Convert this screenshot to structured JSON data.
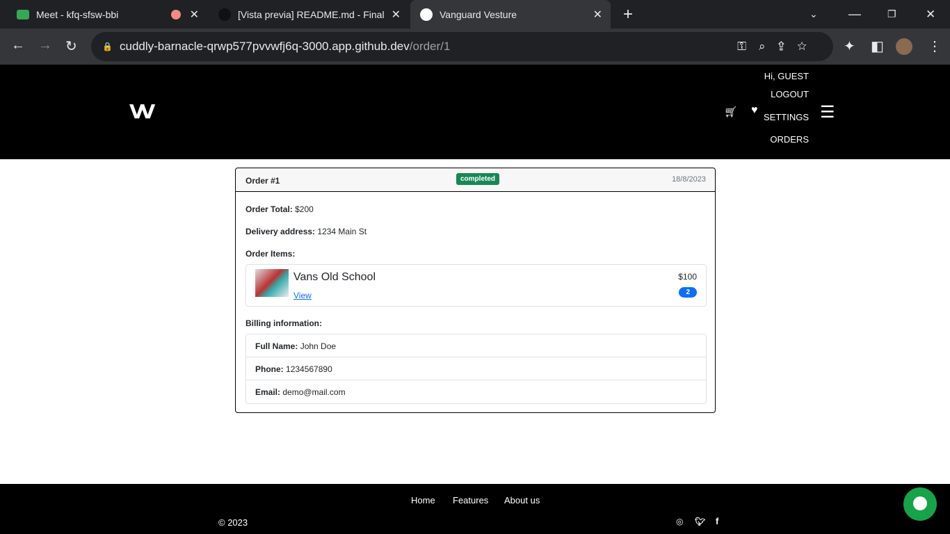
{
  "browser": {
    "tabs": [
      {
        "title": "Meet - kfq-sfsw-bbi"
      },
      {
        "title": "[Vista previa] README.md - Final"
      },
      {
        "title": "Vanguard Vesture"
      }
    ],
    "url_host": "cuddly-barnacle-qrwp577pvvwfj6q-3000.app.github.dev",
    "url_path": "/order/1"
  },
  "header": {
    "logo": "VV",
    "greeting": "Hi, GUEST",
    "menu": [
      "LOGOUT",
      "SETTINGS",
      "ORDERS"
    ]
  },
  "order": {
    "title": "Order #1",
    "status": "completed",
    "status_color": "#198754",
    "date": "18/8/2023",
    "total_label": "Order Total:",
    "total": "$200",
    "address_label": "Delivery address:",
    "address": "1234 Main St",
    "items_label": "Order Items:",
    "items": [
      {
        "name": "Vans Old School",
        "link": "View",
        "price": "$100",
        "qty": "2"
      }
    ],
    "billing_label": "Billing information:",
    "billing": [
      {
        "label": "Full Name:",
        "value": "John Doe"
      },
      {
        "label": "Phone:",
        "value": "1234567890"
      },
      {
        "label": "Email:",
        "value": "demo@mail.com"
      }
    ]
  },
  "footer": {
    "links": [
      "Home",
      "Features",
      "About us"
    ],
    "copyright": "© 2023"
  }
}
